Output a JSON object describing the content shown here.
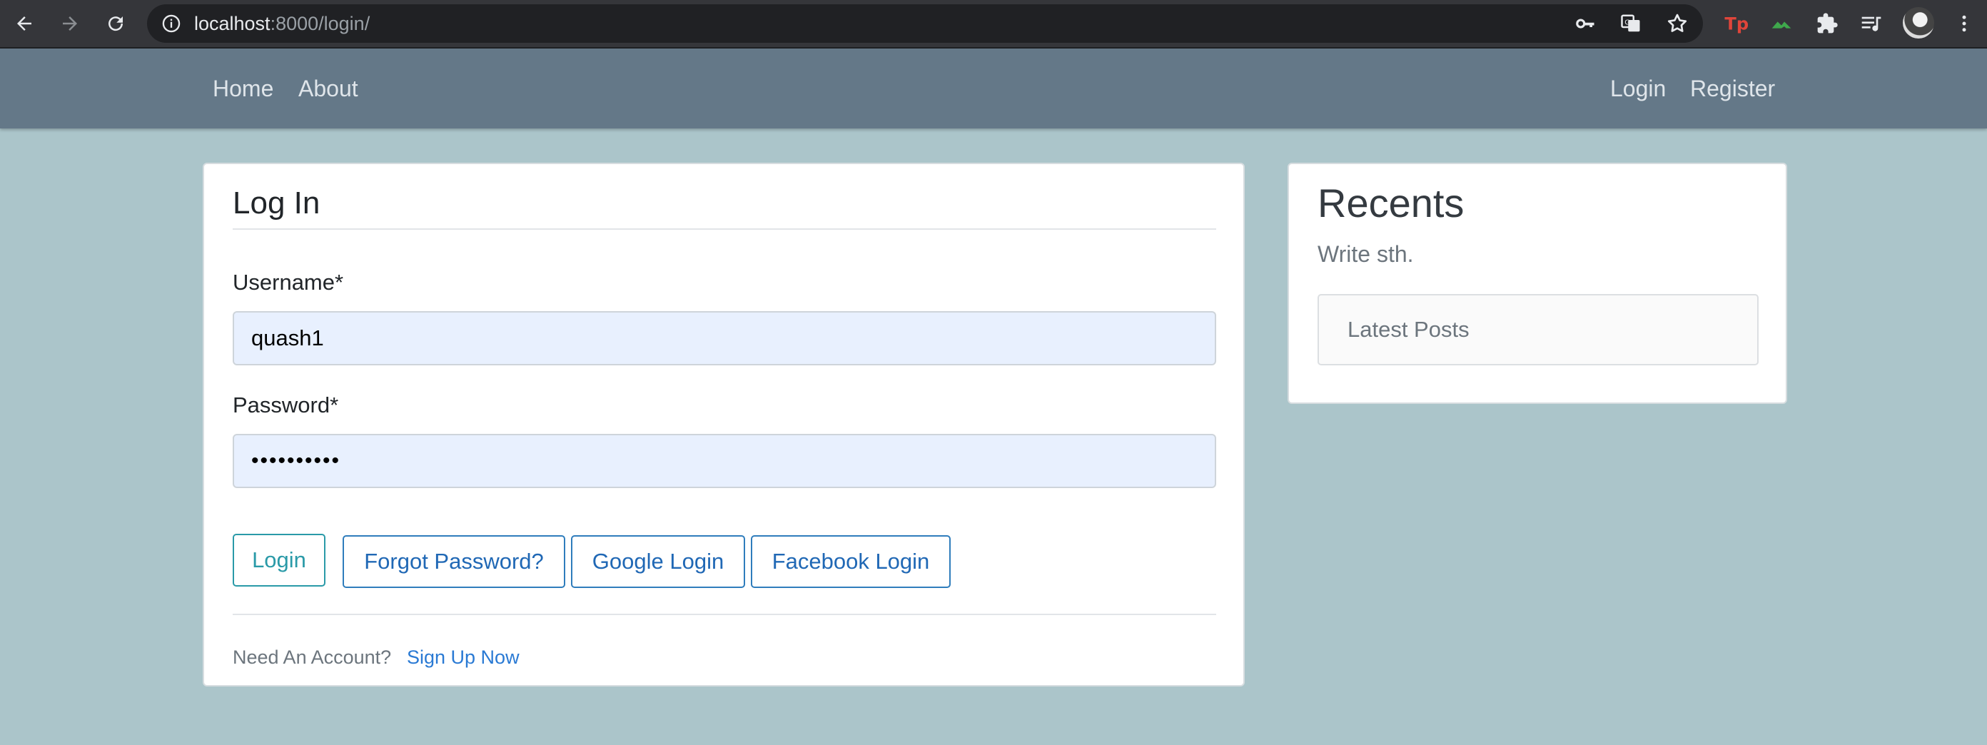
{
  "browser": {
    "url_host": "localhost",
    "url_rest": ":8000/login/",
    "icons": [
      "back-icon",
      "forward-icon",
      "reload-icon",
      "info-icon",
      "key-icon",
      "translate-icon",
      "star-icon",
      "extension-tp-icon",
      "extension-green-icon",
      "puzzle-icon",
      "reading-list-icon",
      "avatar",
      "menu-icon"
    ]
  },
  "nav": {
    "home": "Home",
    "about": "About",
    "login": "Login",
    "register": "Register"
  },
  "login_form": {
    "title": "Log In",
    "username_label": "Username*",
    "username_value": "quash1",
    "password_label": "Password*",
    "password_value": "••••••••••",
    "buttons": {
      "login": "Login",
      "forgot": "Forgot Password?",
      "google": "Google Login",
      "facebook": "Facebook Login"
    },
    "need_account": "Need An Account?",
    "sign_up": "Sign Up Now"
  },
  "recents": {
    "title": "Recents",
    "subtitle": "Write sth.",
    "latest_posts": "Latest Posts"
  },
  "colors": {
    "page_bg": "#abc5ca",
    "navbar_bg": "#647888",
    "autofill_bg": "#e8f0fe",
    "link_blue": "#2a7ad4",
    "login_teal": "#2a9aa8"
  }
}
